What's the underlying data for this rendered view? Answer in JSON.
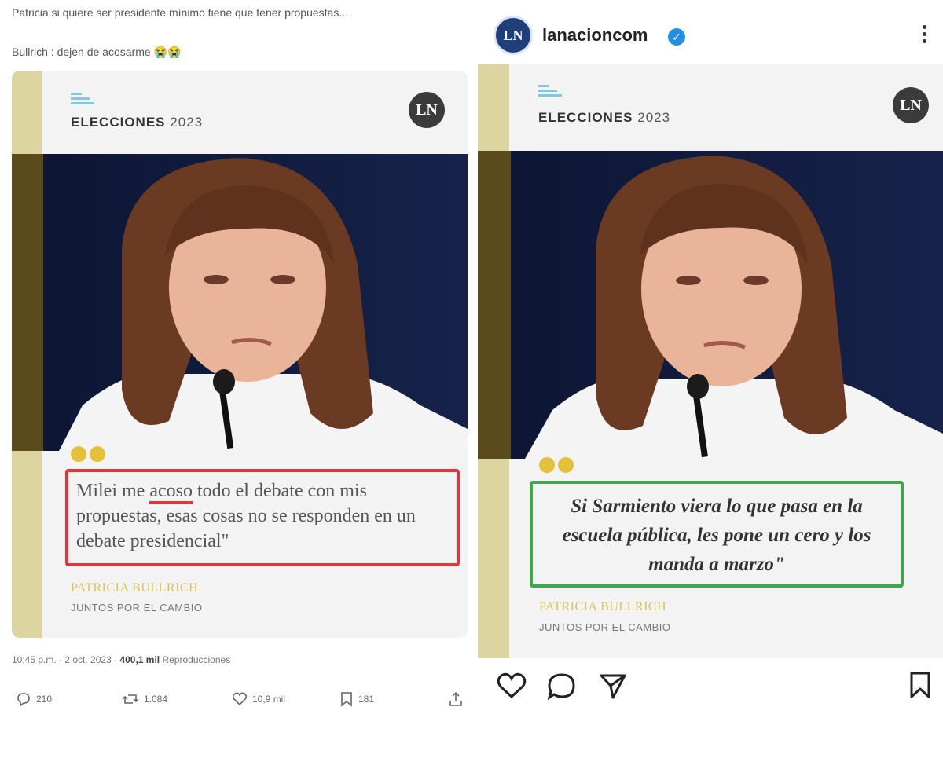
{
  "tweet": {
    "line1": "Patricia si quiere ser presidente mínimo tiene que tener propuestas...",
    "line2": "Bullrich : dejen de acosarme 😭😭",
    "meta_time": "10:45 p.m. · 2 oct. 2023 ·",
    "meta_views": "400,1 mil",
    "meta_views_label": "Reproducciones",
    "actions": {
      "replies": "210",
      "retweets": "1.084",
      "likes": "10,9 mil",
      "bookmarks": "181"
    }
  },
  "instagram": {
    "username": "lanacioncom",
    "verified": true
  },
  "card_left": {
    "section": "ELECCIONES",
    "year": "2023",
    "badge": "LN",
    "quote_pre": "Milei me ",
    "quote_underlined": "acoso",
    "quote_post": " todo el debate con mis propuestas, esas cosas no se responden en un debate presidencial\"",
    "author": "PATRICIA BULLRICH",
    "party": "JUNTOS POR EL CAMBIO",
    "box_color": "#e0353b"
  },
  "card_right": {
    "section": "ELECCIONES",
    "year": "2023",
    "badge": "LN",
    "quote": "Si Sarmiento viera lo que pasa en la escuela pública, les pone un cero y los manda a marzo\"",
    "author": "PATRICIA BULLRICH",
    "party": "JUNTOS POR EL CAMBIO",
    "box_color": "#3fa84f"
  },
  "colors": {
    "stripe": "#ddd5a0",
    "quote_marks": "#e3c13a",
    "author": "#d8c35a",
    "verified": "#1f8fe8"
  }
}
